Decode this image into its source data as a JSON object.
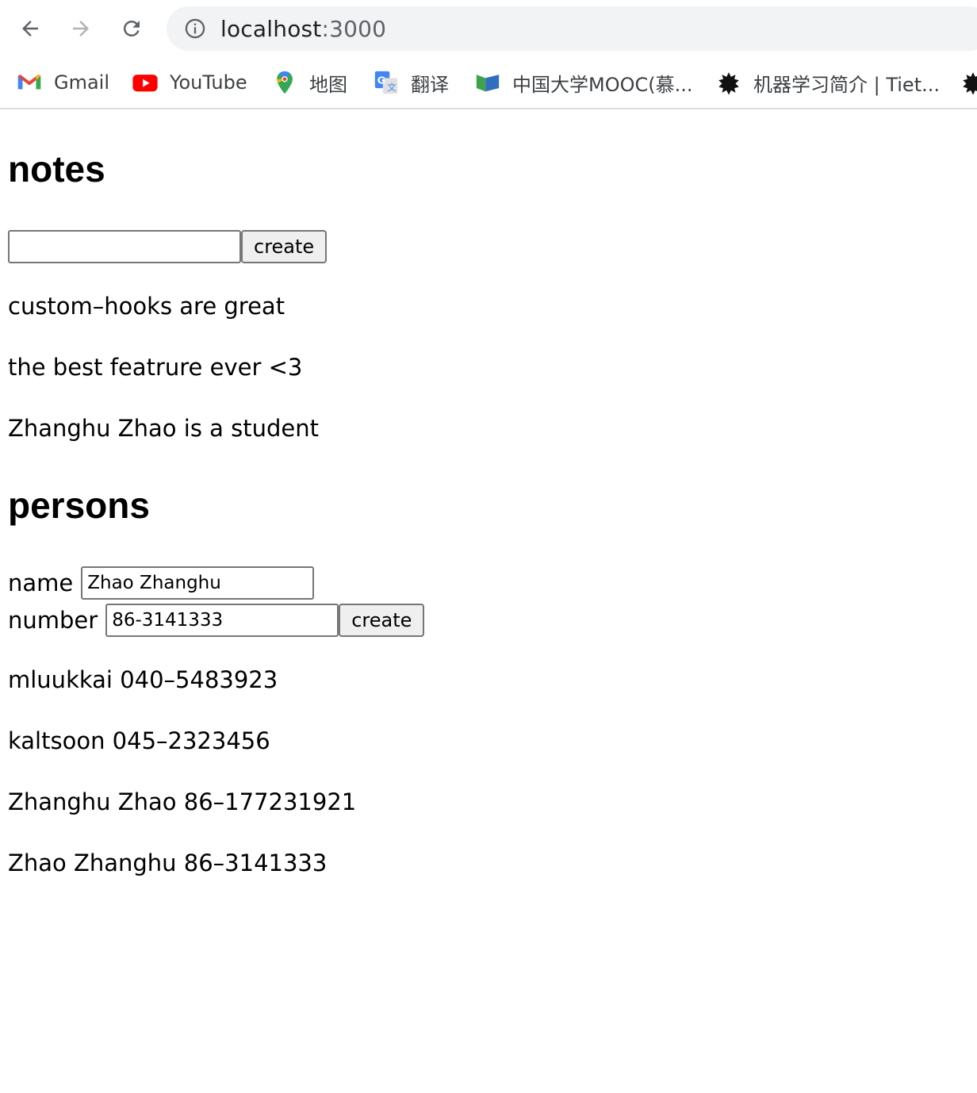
{
  "browser": {
    "url_host": "localhost",
    "url_port": ":3000",
    "bookmarks": [
      {
        "label": "Gmail",
        "icon": "gmail-icon"
      },
      {
        "label": "YouTube",
        "icon": "youtube-icon"
      },
      {
        "label": "地图",
        "icon": "maps-icon"
      },
      {
        "label": "翻译",
        "icon": "translate-icon"
      },
      {
        "label": "中国大学MOOC(慕...",
        "icon": "mooc-icon"
      },
      {
        "label": "机器学习简介 | Tiet...",
        "icon": "helsinki-icon"
      }
    ]
  },
  "notes": {
    "title": "notes",
    "input_value": "",
    "create_label": "create",
    "items": [
      "custom–hooks are great",
      "the best featrure ever <3",
      "Zhanghu Zhao is a student"
    ]
  },
  "persons": {
    "title": "persons",
    "name_label": "name",
    "name_value": "Zhao Zhanghu",
    "number_label": "number",
    "number_value": "86-3141333",
    "create_label": "create",
    "items": [
      "mluukkai 040–5483923",
      "kaltsoon 045–2323456",
      "Zhanghu Zhao 86–177231921",
      "Zhao Zhanghu 86–3141333"
    ]
  },
  "colors": {
    "omnibox_bg": "#f1f3f4",
    "button_bg": "#efefef",
    "border": "#767676"
  }
}
